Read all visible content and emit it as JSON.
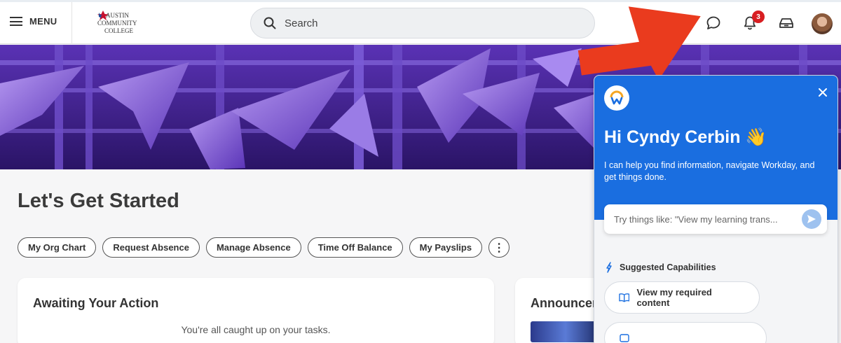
{
  "header": {
    "menu_label": "MENU",
    "logo_lines": [
      "AUSTIN",
      "COMMUNITY",
      "COLLEGE"
    ],
    "search_placeholder": "Search",
    "notifications_count": "3"
  },
  "main": {
    "title": "Let's Get Started",
    "quick_links": [
      "My Org Chart",
      "Request Absence",
      "Manage Absence",
      "Time Off Balance",
      "My Payslips"
    ],
    "more_label": "⋮",
    "awaiting": {
      "title": "Awaiting Your Action",
      "message": "You're all caught up on your tasks."
    },
    "announcements_title": "Announcements"
  },
  "assistant": {
    "greeting": "Hi Cyndy Cerbin 👋",
    "intro": "I can help you find information, navigate Workday, and get things done.",
    "input_placeholder": "Try things like: \"View my learning trans...",
    "suggested_title": "Suggested Capabilities",
    "capabilities": [
      "View my required content"
    ]
  },
  "colors": {
    "assistant_blue": "#1a6ee0",
    "badge_red": "#d81e22",
    "arrow_red": "#ea3b1e",
    "banner_purple": "#6a3fc8"
  }
}
